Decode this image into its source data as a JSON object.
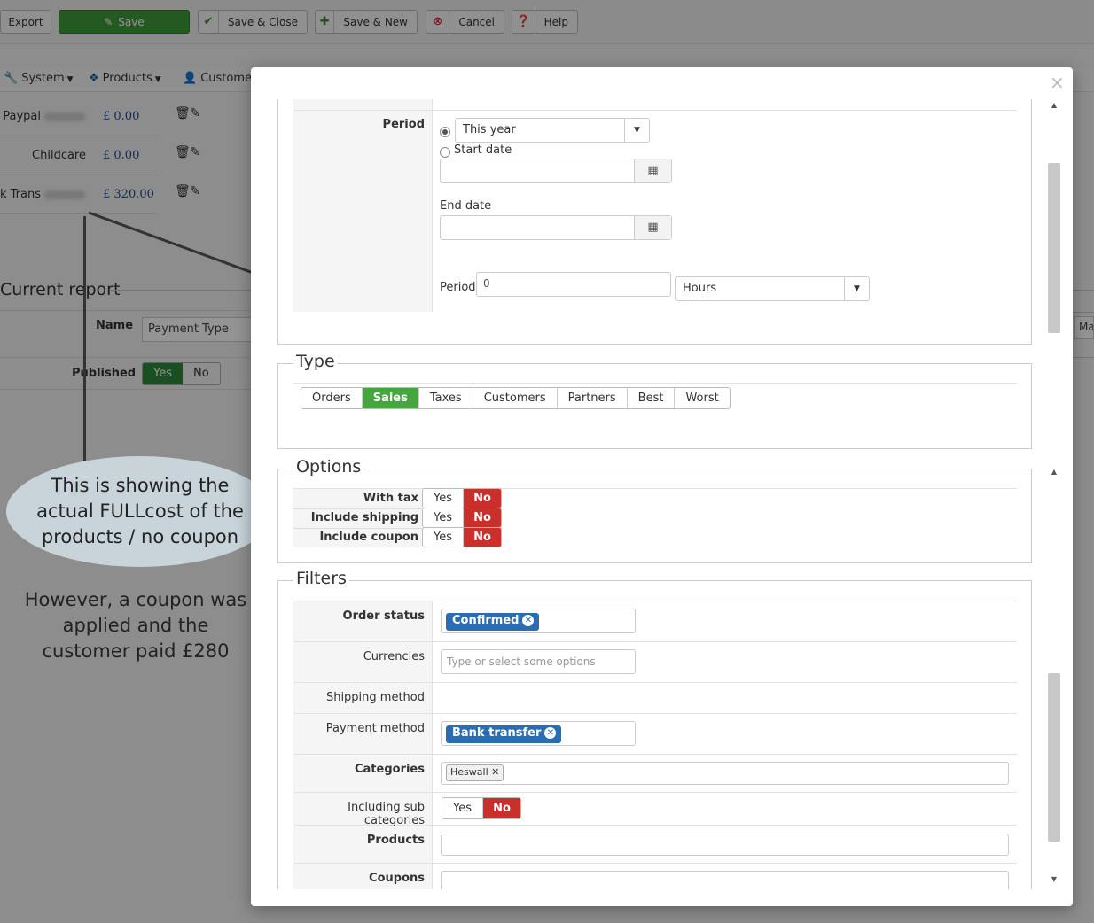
{
  "toolbar": {
    "export": "Export",
    "save": "Save",
    "save_close": "Save & Close",
    "save_new": "Save & New",
    "cancel": "Cancel",
    "help": "Help"
  },
  "menu": {
    "system": "System",
    "products": "Products",
    "customers": "Customers"
  },
  "payments": [
    {
      "name": "Paypal",
      "amount": "£ 0.00"
    },
    {
      "name": "Childcare",
      "amount": "£ 0.00"
    },
    {
      "name": "nk Trans",
      "amount": "£ 320.00"
    }
  ],
  "current_report": {
    "title": "Current report",
    "name_label": "Name",
    "name_value": "Payment Type",
    "published_label": "Published",
    "yes": "Yes",
    "no": "No",
    "right_clip": "Ma"
  },
  "annotations": {
    "bubble": "This is showing the actual FULLcost of the products / no coupon",
    "note": "However, a coupon was applied and the customer paid £280"
  },
  "modal": {
    "close": "×",
    "period": {
      "label": "Period",
      "preset": "This year",
      "start_date": "Start date",
      "end_date": "End date",
      "period_label": "Period",
      "period_value": "0",
      "unit": "Hours"
    },
    "type": {
      "legend": "Type",
      "options": [
        "Orders",
        "Sales",
        "Taxes",
        "Customers",
        "Partners",
        "Best",
        "Worst"
      ],
      "selected": "Sales"
    },
    "options": {
      "legend": "Options",
      "with_tax": "With tax",
      "include_shipping": "Include shipping",
      "include_coupon": "Include coupon",
      "yes": "Yes",
      "no": "No"
    },
    "filters": {
      "legend": "Filters",
      "order_status": "Order status",
      "order_status_tag": "Confirmed",
      "currencies": "Currencies",
      "currencies_placeholder": "Type or select some options",
      "shipping_method": "Shipping method",
      "payment_method": "Payment method",
      "payment_method_tag": "Bank transfer",
      "categories": "Categories",
      "categories_tag": "Heswall",
      "including_sub": "Including sub categories",
      "yes": "Yes",
      "no": "No",
      "products": "Products",
      "coupons": "Coupons"
    }
  },
  "colors": {
    "save_green": "#3f9a3a",
    "active_green": "#45a63d",
    "no_red": "#c9302c",
    "tag_blue": "#2a6db3"
  }
}
